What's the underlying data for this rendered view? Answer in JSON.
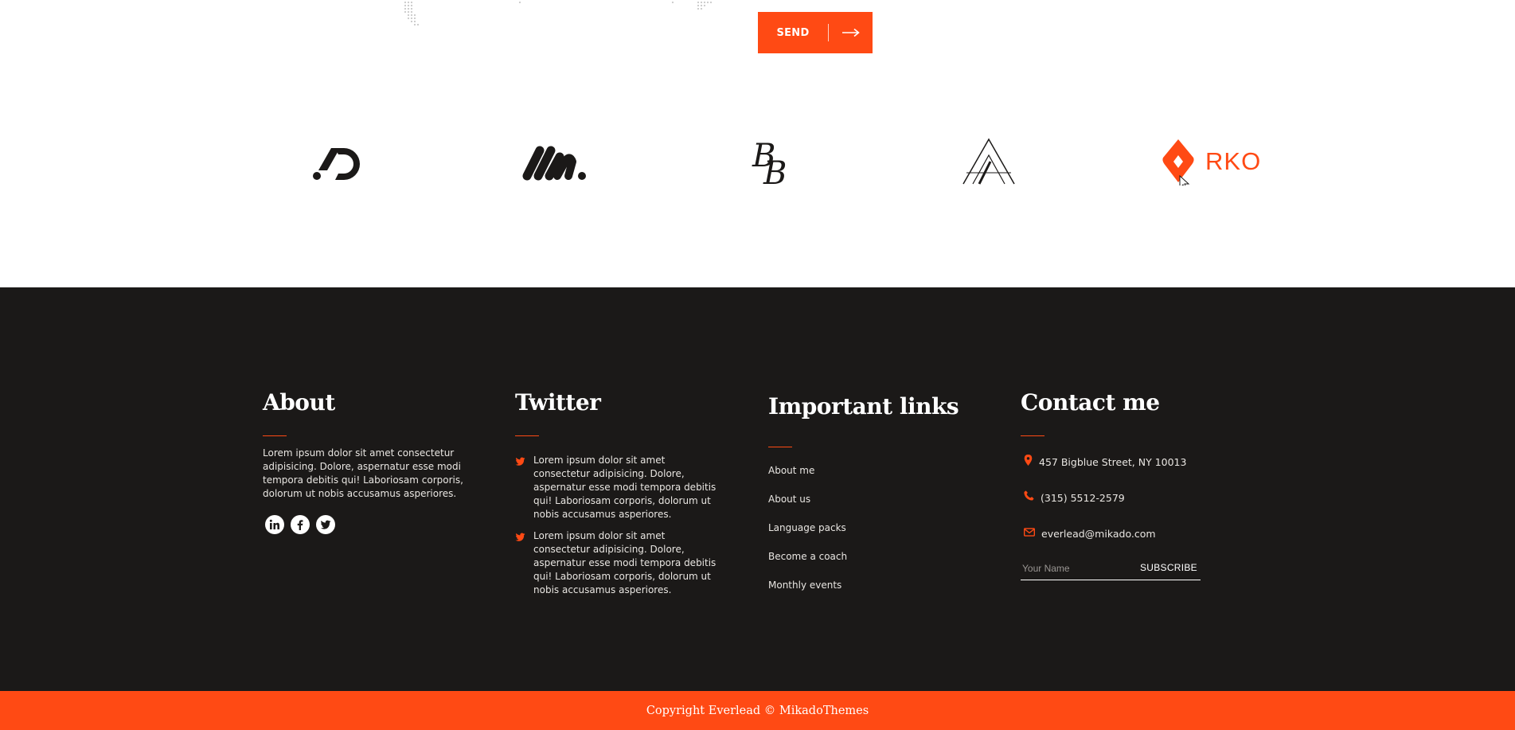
{
  "form": {
    "send_label": "SEND",
    "send_icon": "arrow-right-icon"
  },
  "logos": [
    {
      "name": "ad-logo"
    },
    {
      "name": "m-logo"
    },
    {
      "name": "bb-logo"
    },
    {
      "name": "a-logo"
    },
    {
      "name": "rko-logo",
      "text": "RKO"
    }
  ],
  "footer": {
    "about": {
      "title": "About",
      "text": "Lorem ipsum dolor sit amet consectetur adipisicing. Dolore, aspernatur esse modi tempora debitis qui! Laboriosam corporis, dolorum ut nobis accusamus asperiores.",
      "social": [
        "linkedin-icon",
        "facebook-icon",
        "twitter-icon"
      ]
    },
    "twitter": {
      "title": "Twitter",
      "tweets": [
        {
          "text": "Lorem ipsum dolor sit amet consectetur adipisicing. Dolore, aspernatur esse modi tempora debitis qui! Laboriosam corporis, dolorum ut nobis accusamus asperiores."
        },
        {
          "text": "Lorem ipsum dolor sit amet consectetur adipisicing. Dolore, aspernatur esse modi tempora debitis qui! Laboriosam corporis, dolorum ut nobis accusamus asperiores."
        }
      ]
    },
    "links": {
      "title": "Important links",
      "items": [
        "About me",
        "About us",
        "Language packs",
        "Become a coach",
        "Monthly events"
      ]
    },
    "contact": {
      "title": "Contact me",
      "address": "457 Bigblue Street, NY 10013",
      "phone": "(315) 5512-2579",
      "email": "everlead@mikado.com",
      "name_placeholder": "Your Name",
      "subscribe_label": "SUBSCRIBE"
    }
  },
  "copyright": "Copyright Everlead © MikadoThemes",
  "colors": {
    "accent": "#ff4a14",
    "footer_bg": "#1b1918",
    "white": "#ffffff"
  }
}
